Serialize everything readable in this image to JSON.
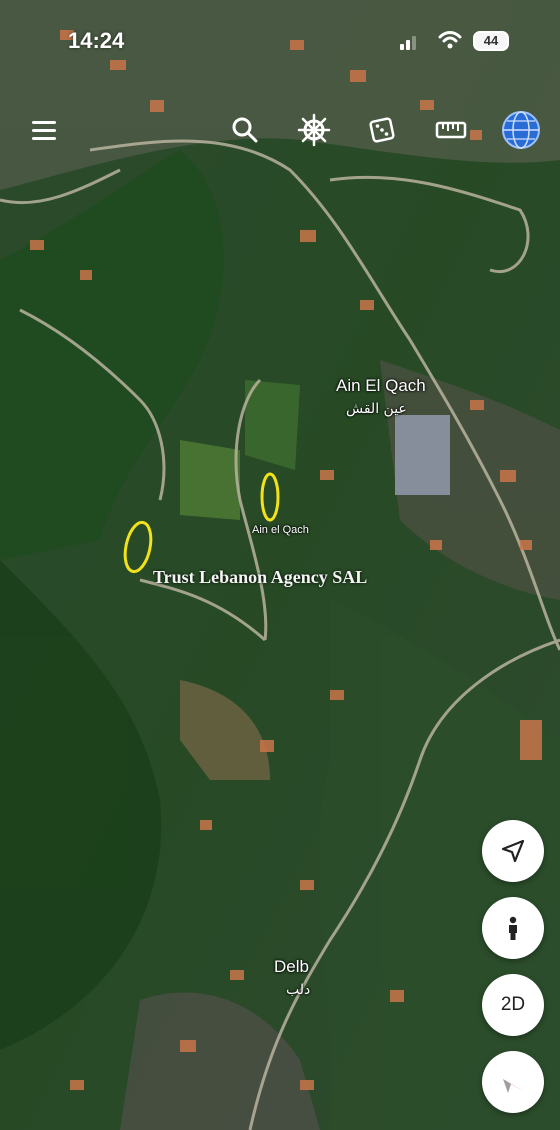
{
  "status": {
    "time": "14:24",
    "battery": "44"
  },
  "toolbar": {
    "icons": [
      "menu-icon",
      "search-icon",
      "ships-wheel-icon",
      "dice-icon",
      "ruler-icon",
      "globe-icon"
    ]
  },
  "labels": {
    "ain_el_qach": "Ain El Qach",
    "ain_el_qach_ar": "عين القش",
    "ain_el_qach_small": "Ain el Qach",
    "watermark": "Trust Lebanon Agency SAL",
    "delb": "Delb",
    "delb_ar": "دلب"
  },
  "controls": {
    "view_mode": "2D"
  },
  "colors": {
    "highlight": "#f2e21b",
    "compass_red": "#e53935",
    "globe_blue": "#2a6cd6"
  }
}
